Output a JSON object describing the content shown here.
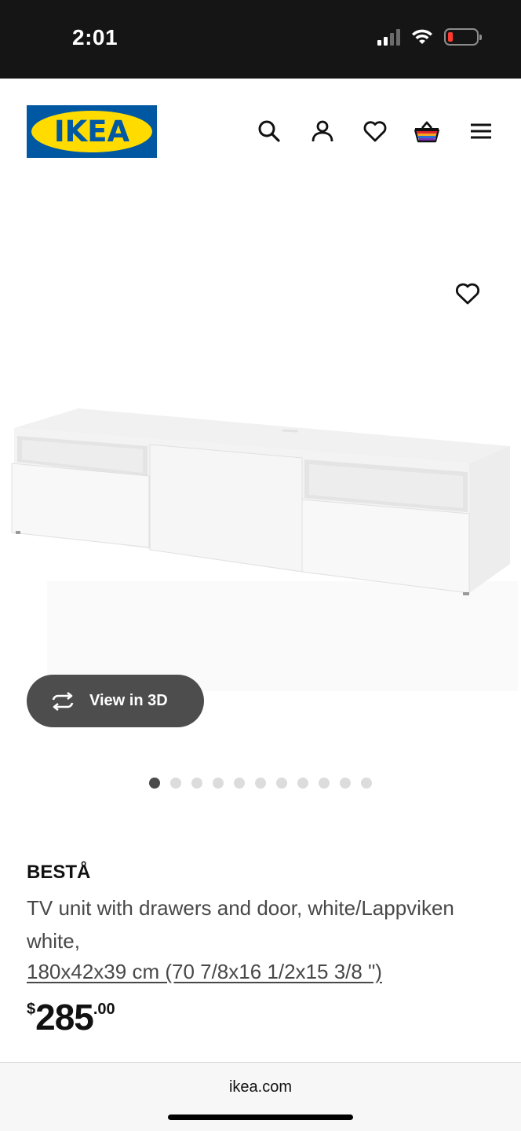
{
  "status_bar": {
    "time": "2:01",
    "icons": [
      "cellular-signal-icon",
      "wifi-icon",
      "battery-low-icon"
    ]
  },
  "header": {
    "logo_text": "IKEA",
    "logo_registered": "®",
    "icons": [
      "search-icon",
      "account-icon",
      "heart-icon",
      "shopping-bag-icon",
      "menu-icon"
    ]
  },
  "gallery": {
    "image": "BESTÅ TV unit, white",
    "view_3d_label": "View in 3D",
    "favorite_icon": "heart-outline-icon",
    "total_images": 11,
    "active_index": 0
  },
  "product": {
    "name": "BESTÅ",
    "description": "TV unit with drawers and door, white/Lappviken white,",
    "size": "180x42x39 cm (70 7/8x16 1/2x15 3/8 \")",
    "price": {
      "currency": "$",
      "integer": "285",
      "decimal": ".00"
    }
  },
  "browser": {
    "url": "ikea.com"
  },
  "colors": {
    "ikea_blue": "#0058a3",
    "ikea_yellow": "#ffdb00",
    "button_dark": "#4d4d4d",
    "status_bar": "#151515"
  }
}
